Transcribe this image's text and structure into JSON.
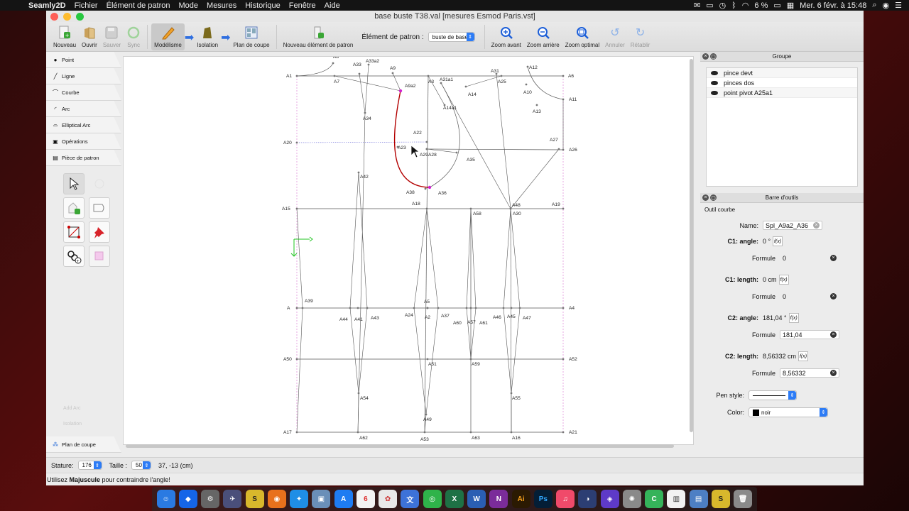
{
  "menubar": {
    "app": "Seamly2D",
    "menus": [
      "Fichier",
      "Élément de patron",
      "Mode",
      "Mesures",
      "Historique",
      "Fenêtre",
      "Aide"
    ],
    "battery": "6 %",
    "datetime": "Mer. 6 févr. à 15:48"
  },
  "window": {
    "title": "base buste T38.val [mesures Esmod Paris.vst]"
  },
  "toolbar": {
    "new": "Nouveau",
    "open": "Ouvrir",
    "save": "Sauver",
    "sync": "Sync",
    "draft": "Modélisme",
    "isolation": "Isolation",
    "layout": "Plan de coupe",
    "new_piece": "Nouveau élément de patron",
    "piece_label": "Élément de patron :",
    "piece_value": "buste de base",
    "zoom_in": "Zoom avant",
    "zoom_out": "Zoom arrière",
    "zoom_fit": "Zoom optimal",
    "undo": "Annuler",
    "redo": "Rétablir"
  },
  "tools": {
    "tabs": [
      "Point",
      "Ligne",
      "Courbe",
      "Arc",
      "Elliptical Arc",
      "Opérations",
      "Pièce de patron"
    ],
    "ghost": [
      "Add Arc",
      "Isolation",
      "Plan de coupe"
    ],
    "bottom_tab": "Plan de coupe"
  },
  "groups": {
    "title": "Groupe",
    "items": [
      "pince devt",
      "pinces dos",
      "point pivot A25a1"
    ]
  },
  "properties": {
    "title": "Barre d'outils",
    "subtitle": "Outil courbe",
    "name_label": "Name:",
    "name_value": "Spl_A9a2_A36",
    "c1_angle_label": "C1: angle:",
    "c1_angle_value": "0 °",
    "c1_angle_formula_label": "Formule",
    "c1_angle_formula": "0",
    "c1_length_label": "C1: length:",
    "c1_length_value": "0 cm",
    "c1_length_formula_label": "Formule",
    "c1_length_formula": "0",
    "c2_angle_label": "C2: angle:",
    "c2_angle_value": "181,04 °",
    "c2_angle_formula_label": "Formule",
    "c2_angle_formula": "181,04",
    "c2_length_label": "C2: length:",
    "c2_length_value": "8,56332 cm",
    "c2_length_formula_label": "Formule",
    "c2_length_formula": "8,56332",
    "pen_label": "Pen style:",
    "color_label": "Color:",
    "color_value": "noir"
  },
  "bottom": {
    "stature_label": "Stature:",
    "stature_value": "176",
    "size_label": "Taille :",
    "size_value": "50",
    "coords": "37, -13 (cm)"
  },
  "status": {
    "prefix": "Utilisez ",
    "key": "Majuscule",
    "suffix": " pour contraindre l'angle!"
  },
  "colors": {
    "accent": "#2d7cf6",
    "curve_selected": "#b30000",
    "point_selected": "#d020d0",
    "axis": "#22c422"
  },
  "pattern_points": [
    {
      "label": "A1"
    },
    {
      "label": "A8"
    },
    {
      "label": "A7"
    },
    {
      "label": "A33"
    },
    {
      "label": "A33a2"
    },
    {
      "label": "A9"
    },
    {
      "label": "A9a2"
    },
    {
      "label": "A3"
    },
    {
      "label": "A31a1"
    },
    {
      "label": "A31"
    },
    {
      "label": "A12"
    },
    {
      "label": "A25"
    },
    {
      "label": "A14"
    },
    {
      "label": "A10"
    },
    {
      "label": "A6"
    },
    {
      "label": "A11"
    },
    {
      "label": "A13"
    },
    {
      "label": "A14a1"
    },
    {
      "label": "A34"
    },
    {
      "label": "A22"
    },
    {
      "label": "A20"
    },
    {
      "label": "A23"
    },
    {
      "label": "A29"
    },
    {
      "label": "A28"
    },
    {
      "label": "A35"
    },
    {
      "label": "A27"
    },
    {
      "label": "A26"
    },
    {
      "label": "A42"
    },
    {
      "label": "A38"
    },
    {
      "label": "A36"
    },
    {
      "label": "A18"
    },
    {
      "label": "A15"
    },
    {
      "label": "A58"
    },
    {
      "label": "A48"
    },
    {
      "label": "A30"
    },
    {
      "label": "A19"
    },
    {
      "label": "A39"
    },
    {
      "label": "A"
    },
    {
      "label": "A5"
    },
    {
      "label": "A44"
    },
    {
      "label": "A41"
    },
    {
      "label": "A43"
    },
    {
      "label": "A24"
    },
    {
      "label": "A2"
    },
    {
      "label": "A37"
    },
    {
      "label": "A60"
    },
    {
      "label": "A57"
    },
    {
      "label": "A61"
    },
    {
      "label": "A46"
    },
    {
      "label": "A45"
    },
    {
      "label": "A47"
    },
    {
      "label": "A4"
    },
    {
      "label": "A50"
    },
    {
      "label": "A51"
    },
    {
      "label": "A59"
    },
    {
      "label": "A52"
    },
    {
      "label": "A54"
    },
    {
      "label": "A55"
    },
    {
      "label": "A49"
    },
    {
      "label": "A17"
    },
    {
      "label": "A62"
    },
    {
      "label": "A53"
    },
    {
      "label": "A63"
    },
    {
      "label": "A16"
    },
    {
      "label": "A21"
    }
  ]
}
